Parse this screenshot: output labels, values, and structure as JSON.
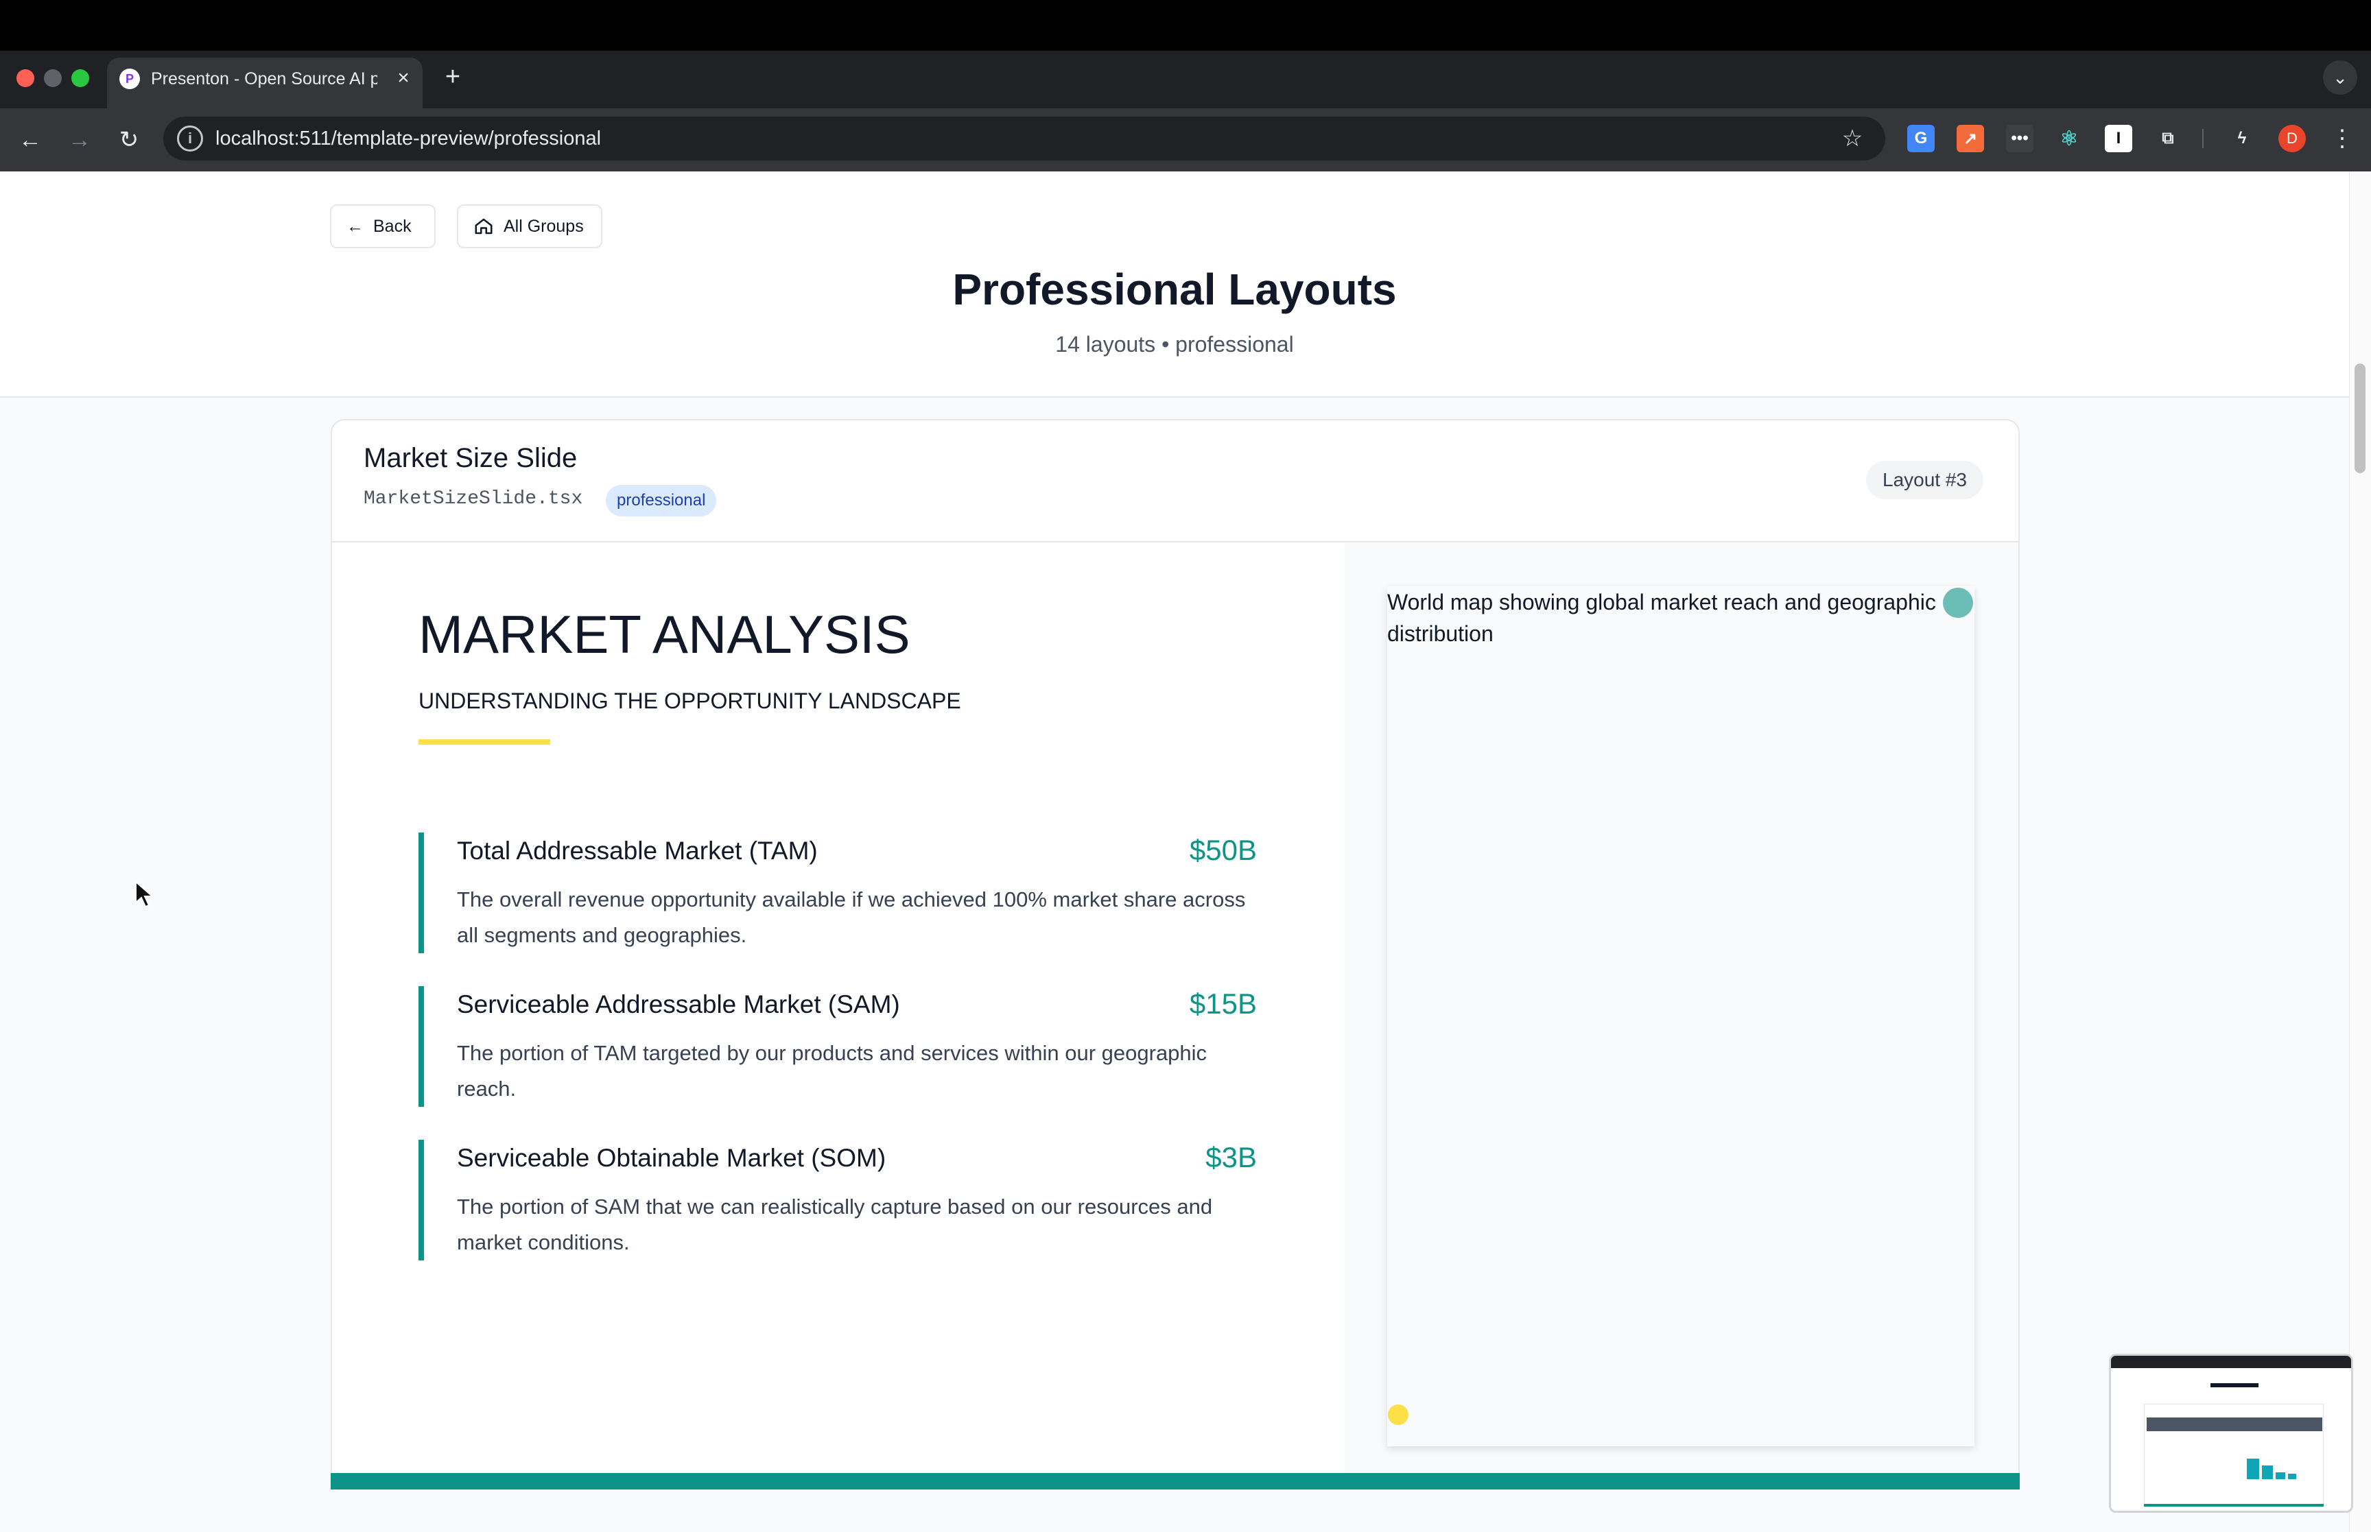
{
  "browser": {
    "tab_title": "Presenton - Open Source AI p",
    "tab_close": "×",
    "new_tab": "+",
    "favicon_letter": "P",
    "url": "localhost:511/template-preview/professional",
    "profile_initial": "D",
    "icons": [
      "back-icon",
      "forward-icon",
      "reload-icon",
      "site-info-icon",
      "star-icon",
      "translate-icon",
      "extension-icons",
      "puzzle-icon",
      "profile-avatar",
      "menu-icon"
    ],
    "colors": {
      "window_bg": "#202124",
      "toolbar": "#35363a",
      "close": "#ff5f57",
      "minimize": "#febc2e",
      "zoom": "#28c840"
    }
  },
  "header": {
    "back_label": "Back",
    "all_groups_label": "All Groups",
    "title": "Professional Layouts",
    "subtitle": "14 layouts • professional"
  },
  "card": {
    "title": "Market Size Slide",
    "file": "MarketSizeSlide.tsx",
    "tag": "professional",
    "layout_number": "Layout #3"
  },
  "slide": {
    "title": "MARKET ANALYSIS",
    "subtitle": "UNDERSTANDING THE OPPORTUNITY LANDSCAPE",
    "image_alt": "World map showing global market reach and geographic distribution",
    "metrics": [
      {
        "name": "Total Addressable Market (TAM)",
        "value": "$50B",
        "description": "The overall revenue opportunity available if we achieved 100% market share across all segments and geographies."
      },
      {
        "name": "Serviceable Addressable Market (SAM)",
        "value": "$15B",
        "description": "The portion of TAM targeted by our products and services within our geographic reach."
      },
      {
        "name": "Serviceable Obtainable Market (SOM)",
        "value": "$3B",
        "description": "The portion of SAM that we can realistically capture based on our resources and market conditions."
      }
    ],
    "colors": {
      "accent": "#0d9488",
      "highlight": "#fde047",
      "text": "#111827"
    }
  }
}
